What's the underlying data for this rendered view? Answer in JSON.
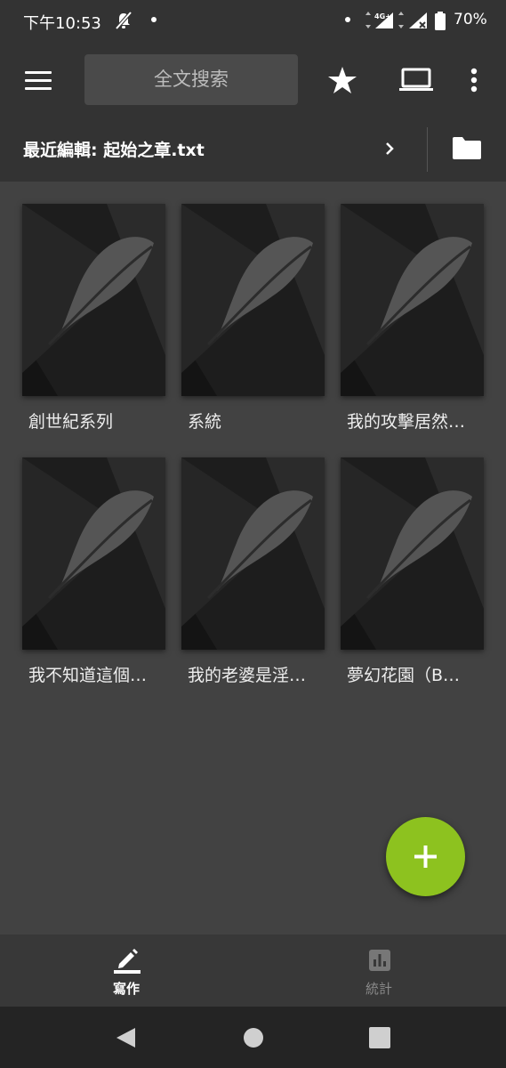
{
  "status_bar": {
    "time": "下午10:53",
    "network": "4G+",
    "battery": "70%",
    "icons": [
      "do-not-disturb-icon",
      "signal-icon",
      "battery-icon"
    ]
  },
  "toolbar": {
    "search_placeholder": "全文搜索",
    "icons": [
      "menu-icon",
      "star-icon",
      "laptop-icon",
      "more-vert-icon"
    ]
  },
  "recent": {
    "label": "最近編輯:  起始之章.txt"
  },
  "books": [
    {
      "title": "創世紀系列"
    },
    {
      "title": "系統"
    },
    {
      "title": "我的攻擊居然…"
    },
    {
      "title": "我不知道這個…"
    },
    {
      "title": "我的老婆是淫…"
    },
    {
      "title": "夢幻花園（B…"
    }
  ],
  "bottom_nav": {
    "items": [
      {
        "label": "寫作",
        "icon": "pencil-icon",
        "active": true
      },
      {
        "label": "統計",
        "icon": "chart-icon",
        "active": false
      }
    ]
  },
  "colors": {
    "background": "#424242",
    "bar": "#333333",
    "fab": "#8dc21f"
  }
}
